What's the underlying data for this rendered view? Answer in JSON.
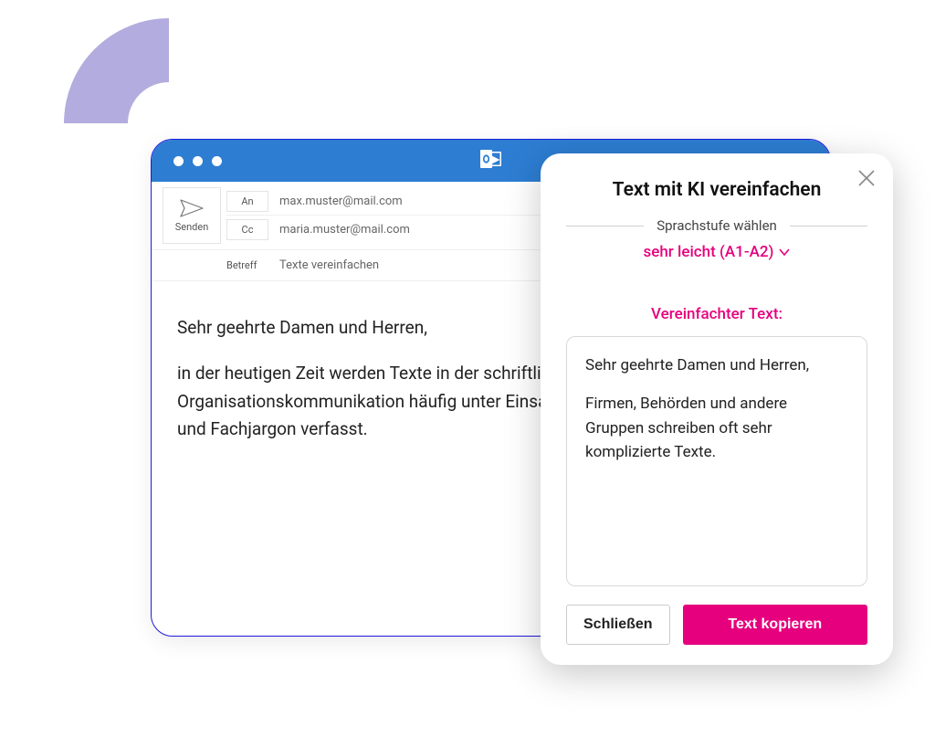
{
  "email": {
    "send_label": "Senden",
    "to_label": "An",
    "cc_label": "Cc",
    "subject_label": "Betreff",
    "to_value": "max.muster@mail.com",
    "cc_value": "maria.muster@mail.com",
    "subject_value": "Texte vereinfachen",
    "body_greeting": "Sehr geehrte Damen und Herren,",
    "body_paragraph": "in der heutigen Zeit werden Texte in der schriftlichen Organisationskommunikation häufig unter Einsatz komplizierter Formulierungen und Fachjargon verfasst."
  },
  "panel": {
    "title": "Text mit KI vereinfachen",
    "level_label": "Sprachstufe wählen",
    "level_selected": "sehr leicht (A1-A2)",
    "simplified_label": "Vereinfachter Text:",
    "simplified_greeting": "Sehr geehrte Damen und Herren,",
    "simplified_paragraph": "Firmen, Behörden und andere Gruppen schreiben oft sehr komplizierte Texte.",
    "close_button": "Schließen",
    "copy_button": "Text kopieren"
  },
  "colors": {
    "accent": "#e6007e",
    "header": "#2d7dd2",
    "border": "#1f1bdd",
    "arc": "#b3acde"
  }
}
